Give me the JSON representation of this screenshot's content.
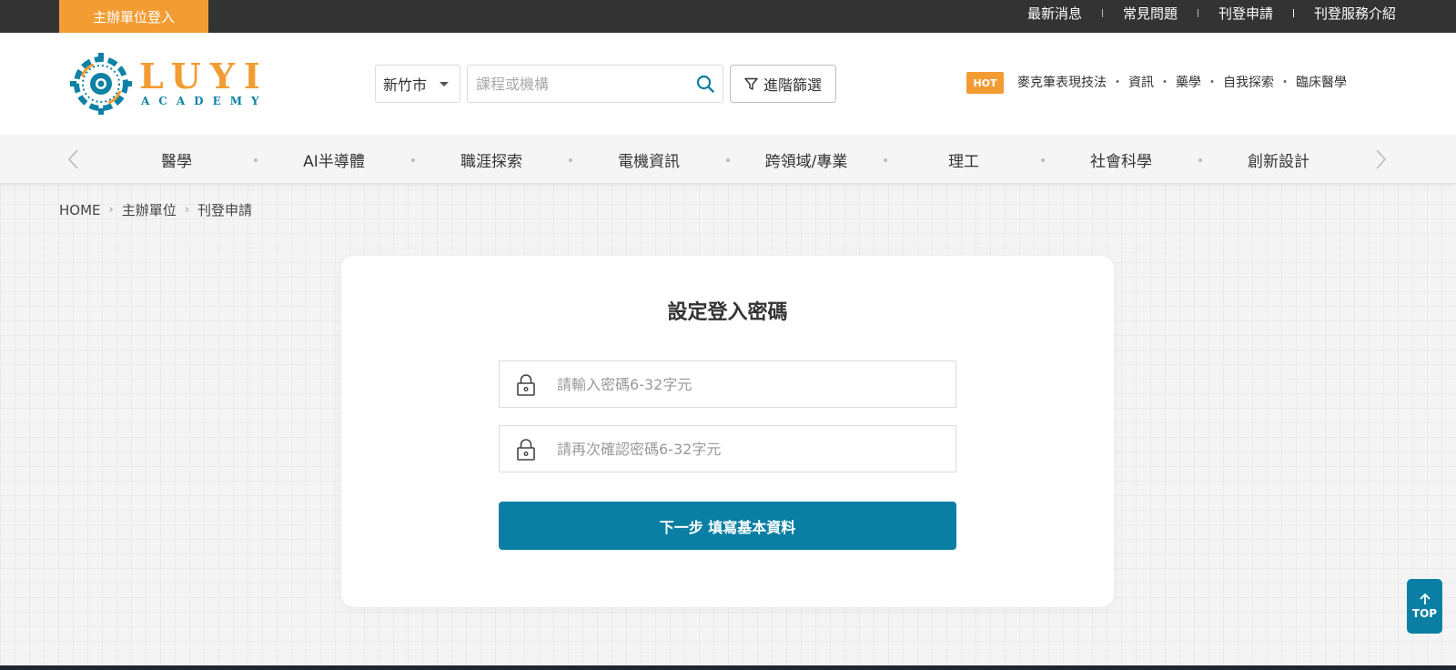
{
  "topbar": {
    "org_login": "主辦單位登入",
    "links": [
      "最新消息",
      "常見問題",
      "刊登申請",
      "刊登服務介紹"
    ]
  },
  "brand": {
    "name": "LUYI",
    "sub": "ACADEMY",
    "primary_color": "#f39c34",
    "accent_color": "#0a7fa3"
  },
  "search": {
    "city": "新竹市",
    "placeholder": "課程或機構",
    "advanced_filter": "進階篩選"
  },
  "hot": {
    "badge": "HOT",
    "keywords": [
      "麥克筆表現技法",
      "資訊",
      "藥學",
      "自我探索",
      "臨床醫學"
    ],
    "separator": "・"
  },
  "categories": [
    "醫學",
    "AI半導體",
    "職涯探索",
    "電機資訊",
    "跨領域/專業",
    "理工",
    "社會科學",
    "創新設計"
  ],
  "breadcrumb": [
    "HOME",
    "主辦單位",
    "刊登申請"
  ],
  "form": {
    "title": "設定登入密碼",
    "password_placeholder": "請輸入密碼6-32字元",
    "confirm_placeholder": "請再次確認密碼6-32字元",
    "submit": "下一步 填寫基本資料"
  },
  "to_top": "TOP"
}
